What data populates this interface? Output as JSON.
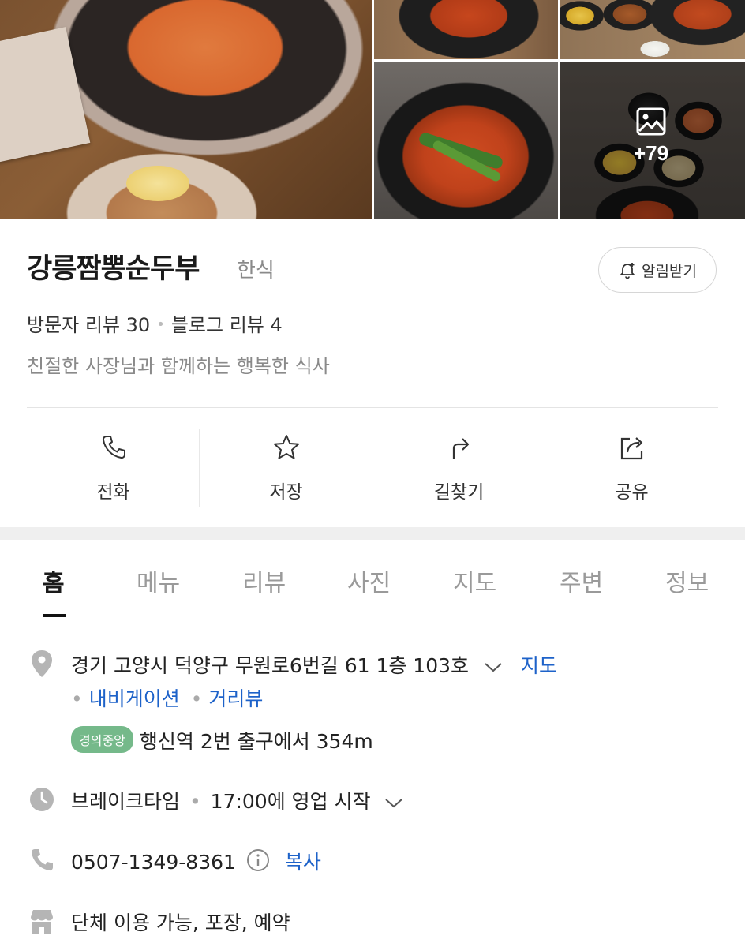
{
  "photos": {
    "more_count": "+79"
  },
  "place": {
    "name": "강릉짬뽕순두부",
    "category": "한식",
    "notify_label": "알림받기",
    "visitor_reviews": "방문자 리뷰 30",
    "blog_reviews": "블로그 리뷰 4",
    "description": "친절한 사장님과 함께하는 행복한 식사"
  },
  "actions": [
    {
      "label": "전화",
      "icon": "phone-icon"
    },
    {
      "label": "저장",
      "icon": "star-icon"
    },
    {
      "label": "길찾기",
      "icon": "directions-icon"
    },
    {
      "label": "공유",
      "icon": "share-icon"
    }
  ],
  "tabs": [
    "홈",
    "메뉴",
    "리뷰",
    "사진",
    "지도",
    "주변",
    "정보"
  ],
  "active_tab": "홈",
  "info": {
    "address": "경기 고양시 덕양구 무원로6번길 61 1층 103호",
    "map_link": "지도",
    "navigation_link": "내비게이션",
    "streetview_link": "거리뷰",
    "subway_line": "경의중앙",
    "subway_text": "행신역 2번 출구에서 354m",
    "hours_status": "브레이크타임",
    "hours_detail": "17:00에 영업 시작",
    "phone": "0507-1349-8361",
    "copy_label": "복사",
    "facilities": "단체 이용 가능, 포장, 예약"
  },
  "colors": {
    "link": "#1d62c9",
    "subway_badge": "#75b98a",
    "icon_gray": "#b5b5b5"
  }
}
